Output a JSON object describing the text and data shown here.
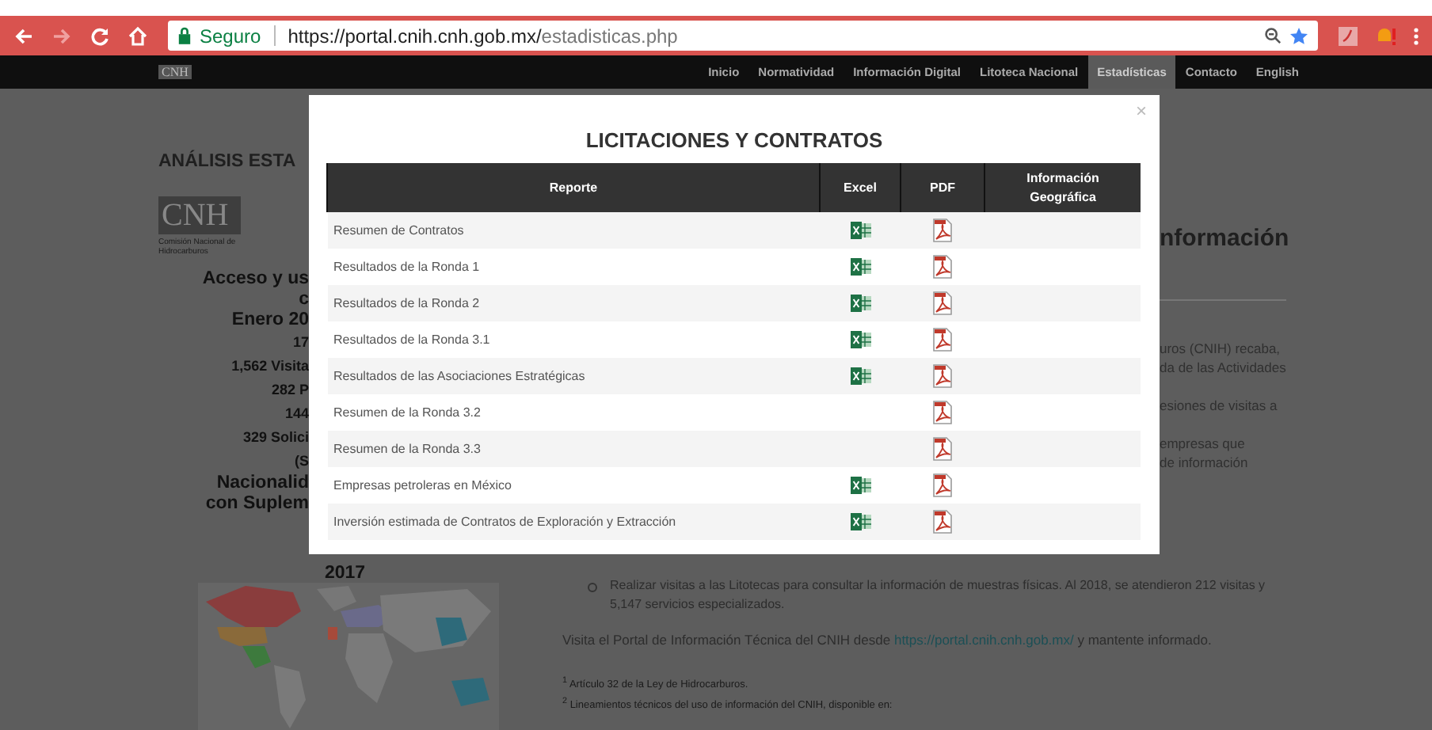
{
  "browser": {
    "security_label": "Seguro",
    "url_host": "https://portal.cnih.cnh.gob.mx/",
    "url_path": "estadisticas.php"
  },
  "nav": {
    "logo": "CNH",
    "items": [
      {
        "label": "Inicio",
        "selected": false
      },
      {
        "label": "Normatividad",
        "selected": false
      },
      {
        "label": "Información Digital",
        "selected": false
      },
      {
        "label": "Litoteca Nacional",
        "selected": false
      },
      {
        "label": "Estadísticas",
        "selected": true
      },
      {
        "label": "Contacto",
        "selected": false
      },
      {
        "label": "English",
        "selected": false
      }
    ]
  },
  "page": {
    "heading": "ANÁLISIS ESTA",
    "logo": {
      "mark": "CNH",
      "caption": "Comisión Nacional de Hidrocarburos"
    },
    "left_lines": [
      {
        "text": "Acceso y us",
        "kind": "title"
      },
      {
        "text": "c",
        "kind": "title"
      },
      {
        "text": "Enero 20",
        "kind": "title"
      },
      {
        "text": "17",
        "kind": "stat"
      },
      {
        "text": "1,562 Visita",
        "kind": "stat"
      },
      {
        "text": "282 P",
        "kind": "stat"
      },
      {
        "text": "144",
        "kind": "stat"
      },
      {
        "text": "329 Solici",
        "kind": "stat"
      },
      {
        "text": "(S",
        "kind": "stat"
      },
      {
        "text": "Nacionalid",
        "kind": "title"
      },
      {
        "text": "con Suplem",
        "kind": "title"
      }
    ],
    "map_title": "2017",
    "right_heading": "nformación",
    "right_paragraphs": [
      [
        "uros (CNIH) recaba,",
        "da de las Actividades"
      ],
      [
        "esiones de visitas a"
      ],
      [
        "empresas que",
        "de información"
      ]
    ],
    "bullet": "Realizar visitas a las Litotecas para consultar la información de muestras físicas. Al 2018, se atendieron 212 visitas y 5,147 servicios especializados.",
    "visit": {
      "before": "Visita el Portal de Información Técnica del CNIH desde",
      "link": "https://portal.cnih.cnh.gob.mx/",
      "after": "y mantente informado."
    },
    "footnotes": [
      "$^{1}$ Artículo 32 de la Ley de Hidrocarburos.",
      "$^{2}$ Lineamientos técnicos del uso de información del CNIH, disponible en:"
    ]
  },
  "modal": {
    "title": "LICITACIONES Y CONTRATOS",
    "close": "×",
    "columns": [
      "Reporte",
      "Excel",
      "PDF",
      "Información Geográfica"
    ],
    "rows": [
      {
        "report": "Resumen de Contratos",
        "excel": true,
        "pdf": true
      },
      {
        "report": "Resultados de la Ronda 1",
        "excel": true,
        "pdf": true
      },
      {
        "report": "Resultados de la Ronda 2",
        "excel": true,
        "pdf": true
      },
      {
        "report": "Resultados de la Ronda 3.1",
        "excel": true,
        "pdf": true
      },
      {
        "report": "Resultados de las Asociaciones Estratégicas",
        "excel": true,
        "pdf": true
      },
      {
        "report": "Resumen de la Ronda 3.2",
        "excel": false,
        "pdf": true
      },
      {
        "report": "Resumen de la Ronda 3.3",
        "excel": false,
        "pdf": true
      },
      {
        "report": "Empresas petroleras en México",
        "excel": true,
        "pdf": true
      },
      {
        "report": "Inversión estimada de Contratos de Exploración y Extracción",
        "excel": true,
        "pdf": true
      }
    ]
  }
}
